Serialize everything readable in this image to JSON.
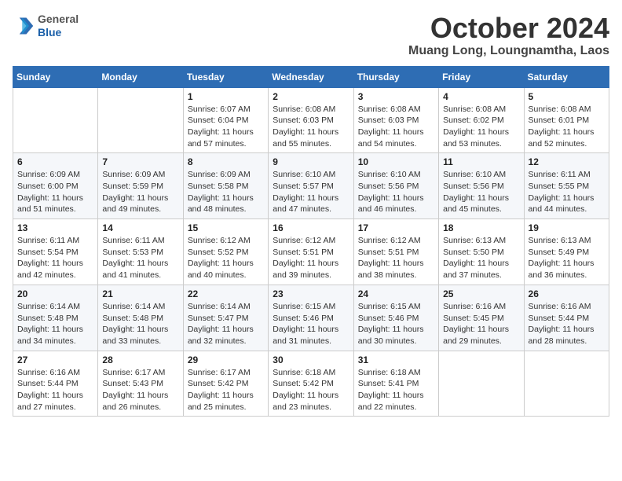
{
  "header": {
    "logo_general": "General",
    "logo_blue": "Blue",
    "month_title": "October 2024",
    "location": "Muang Long, Loungnamtha, Laos"
  },
  "calendar": {
    "weekdays": [
      "Sunday",
      "Monday",
      "Tuesday",
      "Wednesday",
      "Thursday",
      "Friday",
      "Saturday"
    ],
    "weeks": [
      [
        {
          "num": "",
          "info": ""
        },
        {
          "num": "",
          "info": ""
        },
        {
          "num": "1",
          "info": "Sunrise: 6:07 AM\nSunset: 6:04 PM\nDaylight: 11 hours and 57 minutes."
        },
        {
          "num": "2",
          "info": "Sunrise: 6:08 AM\nSunset: 6:03 PM\nDaylight: 11 hours and 55 minutes."
        },
        {
          "num": "3",
          "info": "Sunrise: 6:08 AM\nSunset: 6:03 PM\nDaylight: 11 hours and 54 minutes."
        },
        {
          "num": "4",
          "info": "Sunrise: 6:08 AM\nSunset: 6:02 PM\nDaylight: 11 hours and 53 minutes."
        },
        {
          "num": "5",
          "info": "Sunrise: 6:08 AM\nSunset: 6:01 PM\nDaylight: 11 hours and 52 minutes."
        }
      ],
      [
        {
          "num": "6",
          "info": "Sunrise: 6:09 AM\nSunset: 6:00 PM\nDaylight: 11 hours and 51 minutes."
        },
        {
          "num": "7",
          "info": "Sunrise: 6:09 AM\nSunset: 5:59 PM\nDaylight: 11 hours and 49 minutes."
        },
        {
          "num": "8",
          "info": "Sunrise: 6:09 AM\nSunset: 5:58 PM\nDaylight: 11 hours and 48 minutes."
        },
        {
          "num": "9",
          "info": "Sunrise: 6:10 AM\nSunset: 5:57 PM\nDaylight: 11 hours and 47 minutes."
        },
        {
          "num": "10",
          "info": "Sunrise: 6:10 AM\nSunset: 5:56 PM\nDaylight: 11 hours and 46 minutes."
        },
        {
          "num": "11",
          "info": "Sunrise: 6:10 AM\nSunset: 5:56 PM\nDaylight: 11 hours and 45 minutes."
        },
        {
          "num": "12",
          "info": "Sunrise: 6:11 AM\nSunset: 5:55 PM\nDaylight: 11 hours and 44 minutes."
        }
      ],
      [
        {
          "num": "13",
          "info": "Sunrise: 6:11 AM\nSunset: 5:54 PM\nDaylight: 11 hours and 42 minutes."
        },
        {
          "num": "14",
          "info": "Sunrise: 6:11 AM\nSunset: 5:53 PM\nDaylight: 11 hours and 41 minutes."
        },
        {
          "num": "15",
          "info": "Sunrise: 6:12 AM\nSunset: 5:52 PM\nDaylight: 11 hours and 40 minutes."
        },
        {
          "num": "16",
          "info": "Sunrise: 6:12 AM\nSunset: 5:51 PM\nDaylight: 11 hours and 39 minutes."
        },
        {
          "num": "17",
          "info": "Sunrise: 6:12 AM\nSunset: 5:51 PM\nDaylight: 11 hours and 38 minutes."
        },
        {
          "num": "18",
          "info": "Sunrise: 6:13 AM\nSunset: 5:50 PM\nDaylight: 11 hours and 37 minutes."
        },
        {
          "num": "19",
          "info": "Sunrise: 6:13 AM\nSunset: 5:49 PM\nDaylight: 11 hours and 36 minutes."
        }
      ],
      [
        {
          "num": "20",
          "info": "Sunrise: 6:14 AM\nSunset: 5:48 PM\nDaylight: 11 hours and 34 minutes."
        },
        {
          "num": "21",
          "info": "Sunrise: 6:14 AM\nSunset: 5:48 PM\nDaylight: 11 hours and 33 minutes."
        },
        {
          "num": "22",
          "info": "Sunrise: 6:14 AM\nSunset: 5:47 PM\nDaylight: 11 hours and 32 minutes."
        },
        {
          "num": "23",
          "info": "Sunrise: 6:15 AM\nSunset: 5:46 PM\nDaylight: 11 hours and 31 minutes."
        },
        {
          "num": "24",
          "info": "Sunrise: 6:15 AM\nSunset: 5:46 PM\nDaylight: 11 hours and 30 minutes."
        },
        {
          "num": "25",
          "info": "Sunrise: 6:16 AM\nSunset: 5:45 PM\nDaylight: 11 hours and 29 minutes."
        },
        {
          "num": "26",
          "info": "Sunrise: 6:16 AM\nSunset: 5:44 PM\nDaylight: 11 hours and 28 minutes."
        }
      ],
      [
        {
          "num": "27",
          "info": "Sunrise: 6:16 AM\nSunset: 5:44 PM\nDaylight: 11 hours and 27 minutes."
        },
        {
          "num": "28",
          "info": "Sunrise: 6:17 AM\nSunset: 5:43 PM\nDaylight: 11 hours and 26 minutes."
        },
        {
          "num": "29",
          "info": "Sunrise: 6:17 AM\nSunset: 5:42 PM\nDaylight: 11 hours and 25 minutes."
        },
        {
          "num": "30",
          "info": "Sunrise: 6:18 AM\nSunset: 5:42 PM\nDaylight: 11 hours and 23 minutes."
        },
        {
          "num": "31",
          "info": "Sunrise: 6:18 AM\nSunset: 5:41 PM\nDaylight: 11 hours and 22 minutes."
        },
        {
          "num": "",
          "info": ""
        },
        {
          "num": "",
          "info": ""
        }
      ]
    ]
  }
}
